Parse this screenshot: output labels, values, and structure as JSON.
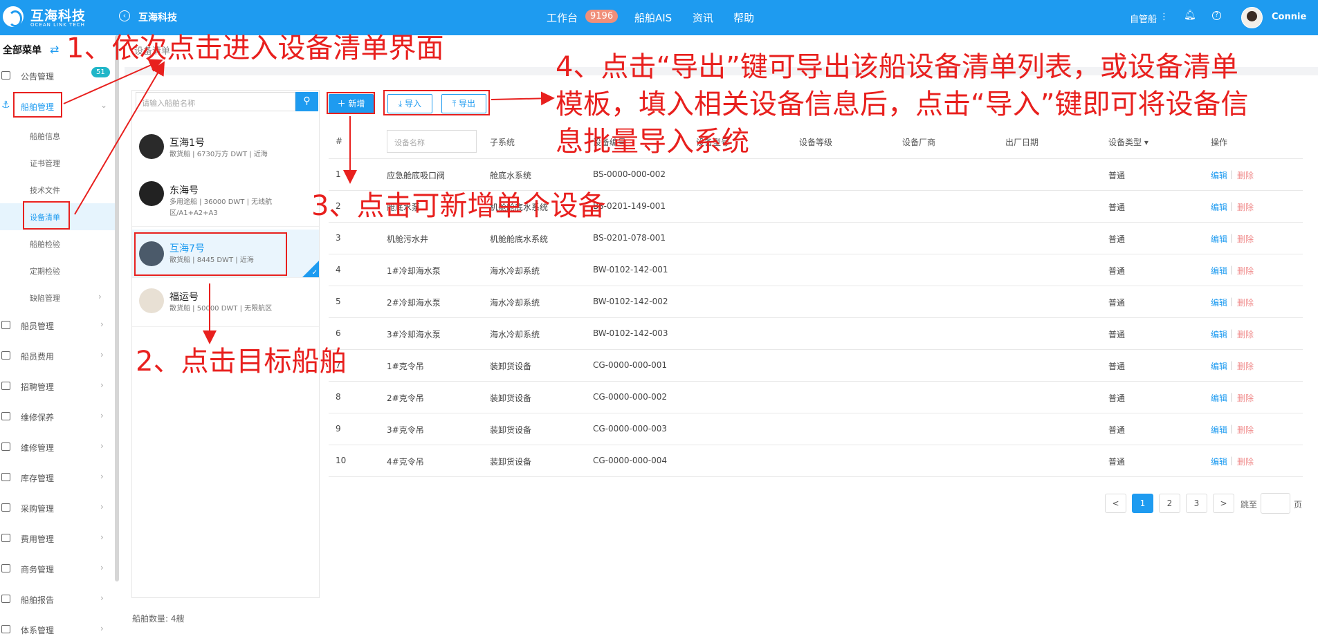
{
  "header": {
    "logo_main": "互海科技",
    "logo_sub": "OCEAN LINK TECH",
    "company": "互海科技",
    "nav": [
      {
        "label": "工作台"
      },
      {
        "label": "船舶AIS"
      },
      {
        "label": "资讯"
      },
      {
        "label": "帮助"
      }
    ],
    "workbench_badge": "9196",
    "ship_mode": "自管船",
    "more_icon": "⋮",
    "username": "Connie"
  },
  "sidebar": {
    "title": "全部菜单",
    "notice_count": "51",
    "items": [
      {
        "label": "公告管理",
        "icon": "book-icon"
      },
      {
        "label": "船舶管理",
        "icon": "anchor-icon"
      },
      {
        "label": "船员管理",
        "icon": "user-icon"
      },
      {
        "label": "船员费用",
        "icon": "wallet-icon"
      },
      {
        "label": "招聘管理",
        "icon": "recruit-icon"
      },
      {
        "label": "维修保养",
        "icon": "hammer-icon"
      },
      {
        "label": "维修管理",
        "icon": "wrench-icon"
      },
      {
        "label": "库存管理",
        "icon": "warehouse-icon"
      },
      {
        "label": "采购管理",
        "icon": "cart-icon"
      },
      {
        "label": "费用管理",
        "icon": "database-icon"
      },
      {
        "label": "商务管理",
        "icon": "globe-icon"
      },
      {
        "label": "船舶报告",
        "icon": "report-icon"
      },
      {
        "label": "体系管理",
        "icon": "document-icon"
      }
    ],
    "sub_items": [
      {
        "label": "船舶信息"
      },
      {
        "label": "证书管理"
      },
      {
        "label": "技术文件"
      },
      {
        "label": "设备清单"
      },
      {
        "label": "船舶检验"
      },
      {
        "label": "定期检验"
      },
      {
        "label": "缺陷管理"
      }
    ]
  },
  "tab": {
    "label": "设备清单"
  },
  "ships": {
    "search_placeholder": "请输入船舶名称",
    "list": [
      {
        "name": "互海1号",
        "meta": "散货船 | 6730万方 DWT | 近海"
      },
      {
        "name": "东海号",
        "meta": "多用途船 | 36000 DWT | 无线航区/A1+A2+A3"
      },
      {
        "name": "互海7号",
        "meta": "散货船 | 8445 DWT | 近海"
      },
      {
        "name": "福运号",
        "meta": "散货船 | 50000 DWT | 无限航区"
      }
    ],
    "count_label": "船舶数量: 4艘"
  },
  "toolbar": {
    "new_label": "新增",
    "import_label": "导入",
    "export_label": "导出"
  },
  "table": {
    "headers": {
      "index": "#",
      "name_placeholder": "设备名称",
      "subsystem": "子系统",
      "code": "设备编号",
      "model": "设备型号",
      "grade": "设备等级",
      "maker": "设备厂商",
      "date": "出厂日期",
      "type": "设备类型",
      "ops": "操作"
    },
    "rows": [
      {
        "no": "1",
        "name": "应急舱底吸口阀",
        "sub": "舱底水系统",
        "code": "BS-0000-000-002",
        "type": "普通"
      },
      {
        "no": "2",
        "name": "舱底水泵",
        "sub": "机舱舱底水系统",
        "code": "BS-0201-149-001",
        "type": "普通"
      },
      {
        "no": "3",
        "name": "机舱污水井",
        "sub": "机舱舱底水系统",
        "code": "BS-0201-078-001",
        "type": "普通"
      },
      {
        "no": "4",
        "name": "1#冷却海水泵",
        "sub": "海水冷却系统",
        "code": "BW-0102-142-001",
        "type": "普通"
      },
      {
        "no": "5",
        "name": "2#冷却海水泵",
        "sub": "海水冷却系统",
        "code": "BW-0102-142-002",
        "type": "普通"
      },
      {
        "no": "6",
        "name": "3#冷却海水泵",
        "sub": "海水冷却系统",
        "code": "BW-0102-142-003",
        "type": "普通"
      },
      {
        "no": "7",
        "name": "1#克令吊",
        "sub": "装卸货设备",
        "code": "CG-0000-000-001",
        "type": "普通"
      },
      {
        "no": "8",
        "name": "2#克令吊",
        "sub": "装卸货设备",
        "code": "CG-0000-000-002",
        "type": "普通"
      },
      {
        "no": "9",
        "name": "3#克令吊",
        "sub": "装卸货设备",
        "code": "CG-0000-000-003",
        "type": "普通"
      },
      {
        "no": "10",
        "name": "4#克令吊",
        "sub": "装卸货设备",
        "code": "CG-0000-000-004",
        "type": "普通"
      }
    ],
    "edit_label": "编辑",
    "sep": "|",
    "delete_label": "删除"
  },
  "pagination": {
    "prev": "<",
    "pages": [
      "1",
      "2",
      "3"
    ],
    "next": ">",
    "jump_label": "跳至",
    "page_unit": "页"
  },
  "annotations": {
    "step1": "1、依次点击进入设备清单界面",
    "step2": "2、点击目标船舶",
    "step3": "3、点击可新增单个设备",
    "step4_line1": "4、点击“导出”键可导出该船设备清单列表，或设备清单",
    "step4_line2": "模板，填入相关设备信息后，点击“导入”键即可将设备信",
    "step4_line3": "息批量导入系统",
    "color": "#e8201e"
  },
  "colors": {
    "primary": "#1e9bf0",
    "annotation": "#e8201e",
    "badge": "#f08f7a",
    "delete": "#f08c8c"
  }
}
